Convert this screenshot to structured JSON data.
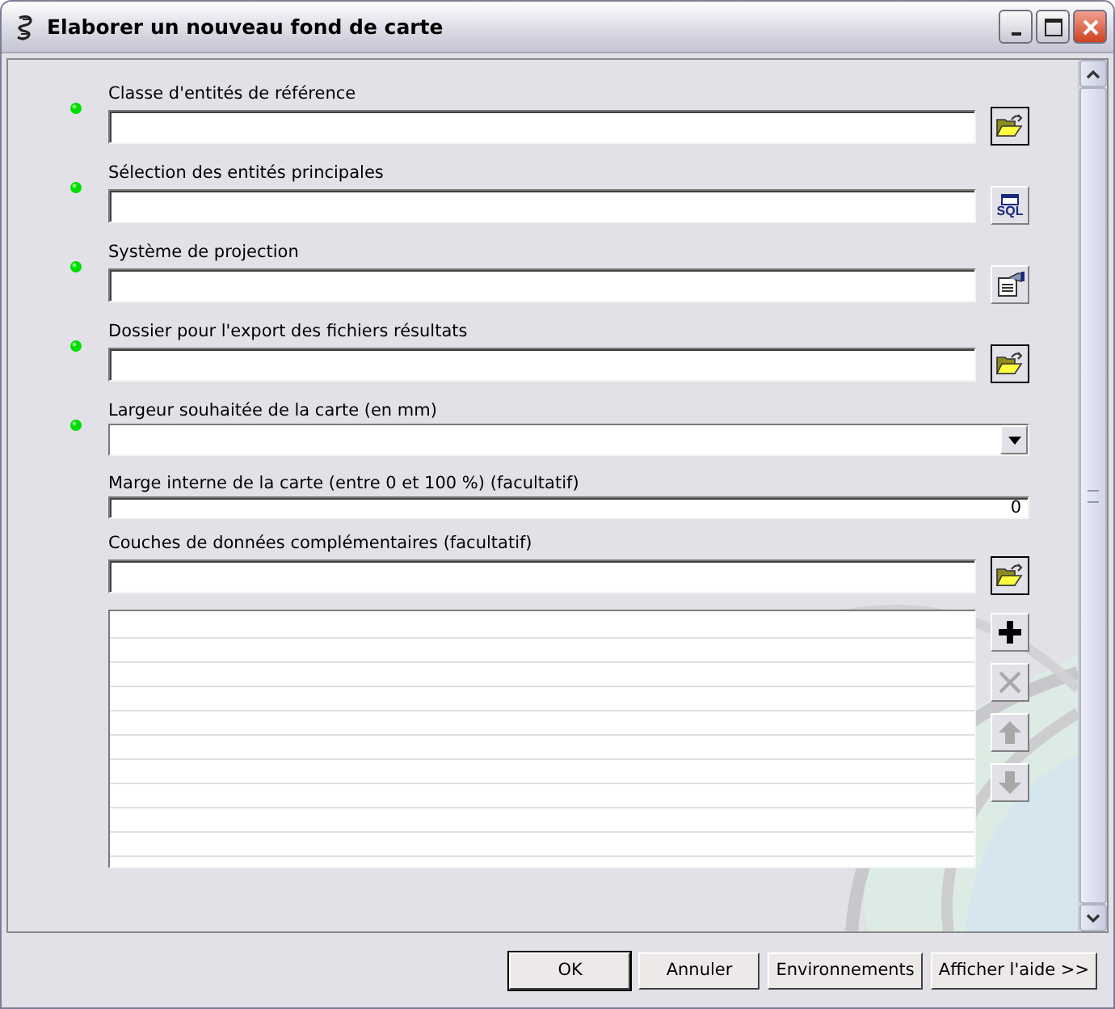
{
  "window": {
    "title": "Elaborer un nouveau fond de carte"
  },
  "parameters": [
    {
      "kind": "browse",
      "label": "Classe d'entités de référence",
      "required": true,
      "button": {
        "kind": "folder"
      }
    },
    {
      "kind": "browse",
      "label": "Sélection des entités principales",
      "required": true,
      "button": {
        "kind": "sql",
        "text": "SQL"
      }
    },
    {
      "kind": "browse",
      "label": "Système de projection",
      "required": true,
      "button": {
        "kind": "properties"
      }
    },
    {
      "kind": "browse",
      "label": "Dossier pour l'export des fichiers résultats",
      "required": true,
      "button": {
        "kind": "folder"
      }
    },
    {
      "kind": "dropdown",
      "label": "Largeur souhaitée de la carte (en mm)",
      "required": true
    },
    {
      "kind": "number",
      "label": "Marge interne de la carte (entre 0 et 100 %) (facultatif)",
      "required": false,
      "value": "0"
    },
    {
      "kind": "list",
      "label": "Couches de données complémentaires (facultatif)",
      "required": false,
      "button": {
        "kind": "folder"
      },
      "actions": [
        {
          "kind": "add",
          "disabled": false
        },
        {
          "kind": "remove",
          "disabled": true
        },
        {
          "kind": "up",
          "disabled": true
        },
        {
          "kind": "down",
          "disabled": true
        }
      ]
    }
  ],
  "buttons": [
    {
      "label": "OK",
      "default": true
    },
    {
      "label": "Annuler",
      "default": false
    },
    {
      "label": "Environnements",
      "default": false
    },
    {
      "label": "Afficher l'aide >>",
      "default": false
    }
  ]
}
